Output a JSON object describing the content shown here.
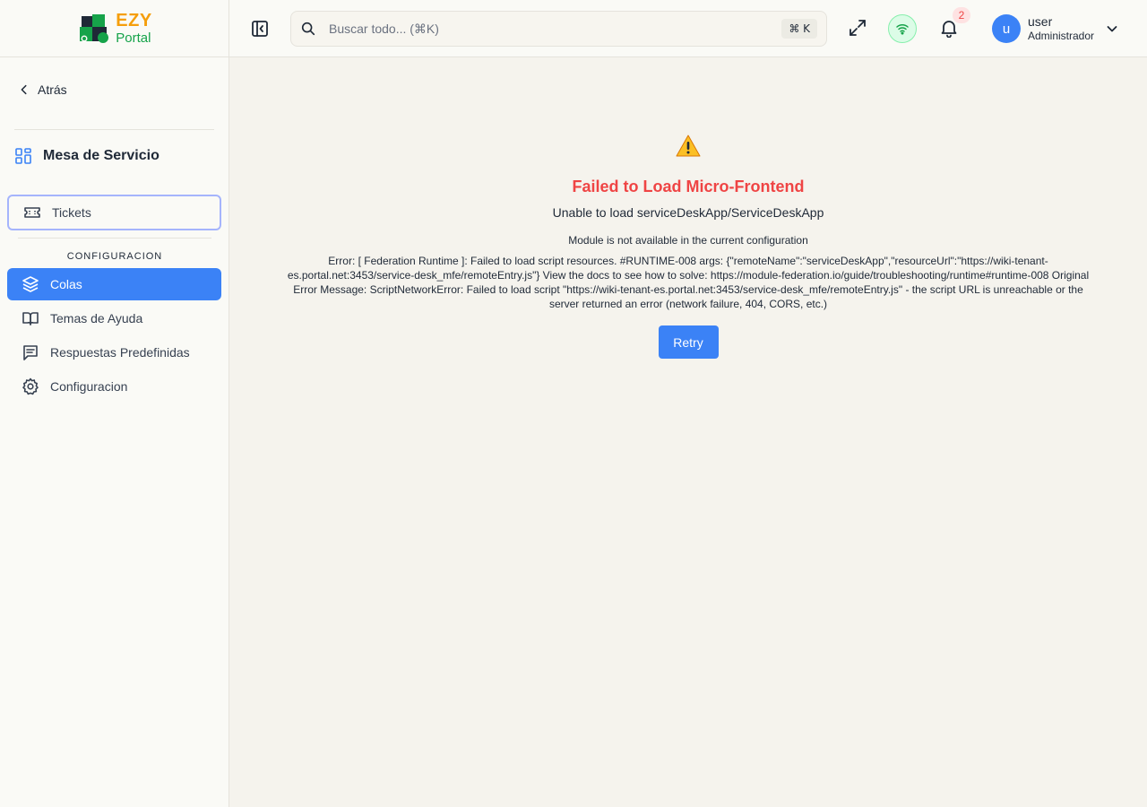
{
  "brand": {
    "logo_top": "EZY",
    "logo_bottom": "Portal",
    "colors": {
      "orange": "#f59e0b",
      "green": "#16a34a"
    }
  },
  "sidebar": {
    "back_label": "Atrás",
    "section_title": "Mesa de Servicio",
    "items": [
      {
        "label": "Tickets",
        "icon": "ticket-icon",
        "state": "focused"
      },
      {
        "label": "Colas",
        "icon": "layers-icon",
        "state": "active"
      },
      {
        "label": "Temas de Ayuda",
        "icon": "book-icon"
      },
      {
        "label": "Respuestas Predefinidas",
        "icon": "message-list-icon"
      },
      {
        "label": "Configuracion",
        "icon": "gear-icon"
      }
    ],
    "group_label": "CONFIGURACION"
  },
  "header": {
    "search": {
      "placeholder": "Buscar todo... (⌘K)",
      "shortcut": "⌘ K"
    },
    "notifications_count": "2",
    "user": {
      "initial": "u",
      "name": "user",
      "role": "Administrador"
    }
  },
  "error": {
    "icon": "warning-icon",
    "title": "Failed to Load Micro-Frontend",
    "subtitle": "Unable to load serviceDeskApp/ServiceDeskApp",
    "module_message": "Module is not available in the current configuration",
    "detail": "Error: [ Federation Runtime ]: Failed to load script resources. #RUNTIME-008 args: {\"remoteName\":\"serviceDeskApp\",\"resourceUrl\":\"https://wiki-tenant-es.portal.net:3453/service-desk_mfe/remoteEntry.js\"} View the docs to see how to solve: https://module-federation.io/guide/troubleshooting/runtime#runtime-008 Original Error Message: ScriptNetworkError: Failed to load script \"https://wiki-tenant-es.portal.net:3453/service-desk_mfe/remoteEntry.js\" - the script URL is unreachable or the server returned an error (network failure, 404, CORS, etc.)",
    "retry_label": "Retry"
  },
  "theme": {
    "accent": "#3b82f6",
    "error_red": "#ef4444",
    "background": "#f5f3ed"
  }
}
